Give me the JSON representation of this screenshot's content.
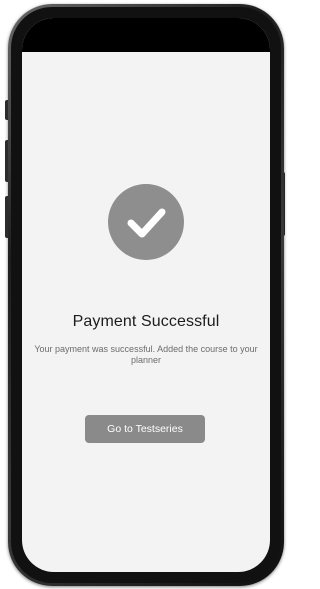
{
  "success": {
    "icon": "check-icon",
    "title": "Payment Successful",
    "message": "Your payment was successful. Added the course to your planner",
    "button_label": "Go to Testseries"
  },
  "colors": {
    "icon_circle": "#8e8e8e",
    "button_bg": "#8a8a8a",
    "screen_bg": "#f3f3f3",
    "title_text": "#1c1c1c",
    "message_text": "#6c6c6c"
  }
}
